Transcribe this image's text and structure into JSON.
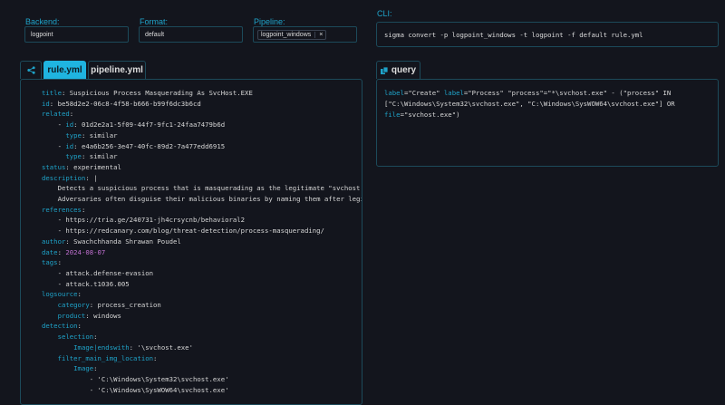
{
  "backend": {
    "label": "Backend:",
    "value": "logpoint"
  },
  "format": {
    "label": "Format:",
    "value": "default"
  },
  "pipeline": {
    "label": "Pipeline:",
    "chip": "logpoint_windows",
    "remove": "×"
  },
  "cli": {
    "label": "CLI:",
    "command": "sigma convert -p logpoint_windows -t logpoint -f default rule.yml"
  },
  "tabs": {
    "share_icon": "share-icon",
    "rule": "rule.yml",
    "pipeline": "pipeline.yml"
  },
  "query_tab": {
    "icon": "copy-icon",
    "label": "query"
  },
  "query_lines": [
    [
      [
        "k",
        "label"
      ],
      [
        "v",
        "=\"Create\" "
      ],
      [
        "k",
        "label"
      ],
      [
        "v",
        "=\"Process\" \"process\"=\"*\\svchost.exe\" - (\"process\" IN"
      ]
    ],
    [
      [
        "v",
        "[\"C:\\Windows\\System32\\svchost.exe\", \"C:\\Windows\\SysWOW64\\svchost.exe\"] OR"
      ]
    ],
    [
      [
        "k",
        "file"
      ],
      [
        "v",
        "=\"svchost.exe\")"
      ]
    ]
  ],
  "code_lines": [
    {
      "i": "",
      "k": "title",
      "v": "Suspicious Process Masquerading As SvcHost.EXE"
    },
    {
      "i": "",
      "k": "id",
      "v": "be58d2e2-06c8-4f58-b666-b99f6dc3b6cd"
    },
    {
      "i": "",
      "k": "related",
      "v": ""
    },
    {
      "i": "    - ",
      "k": "id",
      "v": "01d2e2a1-5f09-44f7-9fc1-24faa7479b6d"
    },
    {
      "i": "      ",
      "k": "type",
      "v": "similar"
    },
    {
      "i": "    - ",
      "k": "id",
      "v": "e4a6b256-3e47-40fc-89d2-7a477edd6915"
    },
    {
      "i": "      ",
      "k": "type",
      "v": "similar"
    },
    {
      "i": "",
      "k": "status",
      "v": "experimental"
    },
    {
      "i": "",
      "k": "description",
      "v": "|"
    },
    {
      "i": "    ",
      "k": "",
      "v": "Detects a suspicious process that is masquerading as the legitimate \"svchost.exe\" by naming its binary \"svchost.exe\""
    },
    {
      "i": "    ",
      "k": "",
      "v": "Adversaries often disguise their malicious binaries by naming them after legitimate system processes"
    },
    {
      "i": "",
      "k": "references",
      "v": ""
    },
    {
      "i": "    ",
      "k": "",
      "v": "- https://tria.ge/240731-jh4crsycnb/behavioral2"
    },
    {
      "i": "    ",
      "k": "",
      "v": "- https://redcanary.com/blog/threat-detection/process-masquerading/"
    },
    {
      "i": "",
      "k": "author",
      "v": "Swachchhanda Shrawan Poudel"
    },
    {
      "i": "",
      "k": "date",
      "v": "2024-08-07",
      "c": "p"
    },
    {
      "i": "",
      "k": "tags",
      "v": ""
    },
    {
      "i": "    ",
      "k": "",
      "v": "- attack.defense-evasion"
    },
    {
      "i": "    ",
      "k": "",
      "v": "- attack.t1036.005"
    },
    {
      "i": "",
      "k": "logsource",
      "v": ""
    },
    {
      "i": "    ",
      "k": "category",
      "v": "process_creation"
    },
    {
      "i": "    ",
      "k": "product",
      "v": "windows"
    },
    {
      "i": "",
      "k": "detection",
      "v": ""
    },
    {
      "i": "    ",
      "k": "selection",
      "v": ""
    },
    {
      "i": "        ",
      "k": "Image|endswith",
      "v": "'\\svchost.exe'"
    },
    {
      "i": "    ",
      "k": "filter_main_img_location",
      "v": ""
    },
    {
      "i": "        ",
      "k": "Image",
      "v": ""
    },
    {
      "i": "            ",
      "k": "",
      "v": "- 'C:\\Windows\\System32\\svchost.exe'"
    },
    {
      "i": "            ",
      "k": "",
      "v": "- 'C:\\Windows\\SysWOW64\\svchost.exe'"
    }
  ]
}
